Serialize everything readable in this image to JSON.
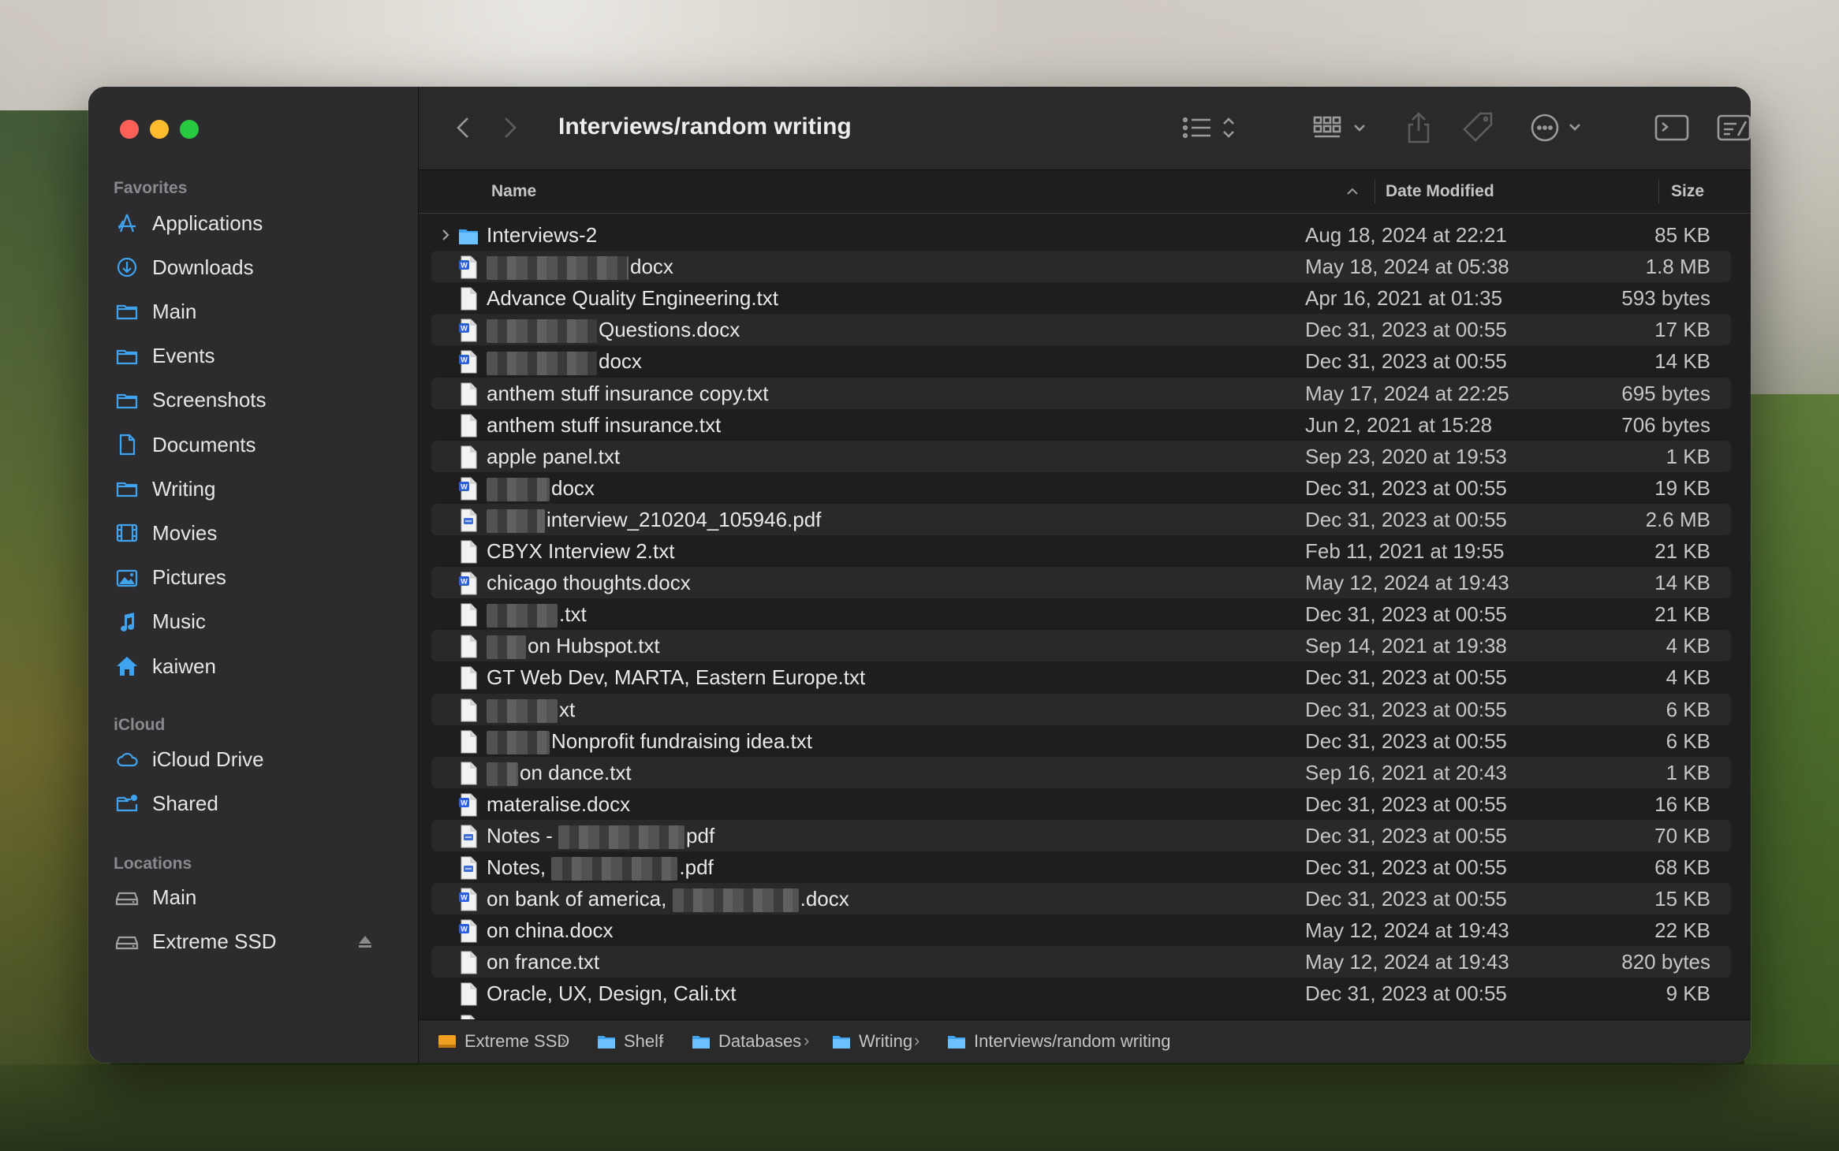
{
  "window": {
    "title": "Interviews/random writing"
  },
  "sidebar": {
    "favorites_label": "Favorites",
    "favorites": [
      {
        "label": "Applications",
        "icon": "applications-icon"
      },
      {
        "label": "Downloads",
        "icon": "downloads-icon"
      },
      {
        "label": "Main",
        "icon": "folder-icon"
      },
      {
        "label": "Events",
        "icon": "folder-icon"
      },
      {
        "label": "Screenshots",
        "icon": "folder-icon"
      },
      {
        "label": "Documents",
        "icon": "document-icon"
      },
      {
        "label": "Writing",
        "icon": "folder-icon"
      },
      {
        "label": "Movies",
        "icon": "film-icon"
      },
      {
        "label": "Pictures",
        "icon": "photo-icon"
      },
      {
        "label": "Music",
        "icon": "music-note-icon"
      },
      {
        "label": "kaiwen",
        "icon": "home-icon"
      }
    ],
    "icloud_label": "iCloud",
    "icloud": [
      {
        "label": "iCloud Drive",
        "icon": "cloud-icon"
      },
      {
        "label": "Shared",
        "icon": "shared-folder-icon"
      }
    ],
    "locations_label": "Locations",
    "locations": [
      {
        "label": "Main",
        "icon": "drive-icon"
      },
      {
        "label": "Extreme SSD",
        "icon": "drive-icon"
      }
    ]
  },
  "columns": {
    "name": "Name",
    "date": "Date Modified",
    "size": "Size"
  },
  "files": [
    {
      "name": "Interviews-2",
      "date": "Aug 18, 2024 at 22:21",
      "size": "85 KB",
      "type": "folder"
    },
    {
      "name": "docx",
      "date": "May 18, 2024 at 05:38",
      "size": "1.8 MB",
      "type": "docx",
      "blur": true
    },
    {
      "name": "Advance Quality Engineering.txt",
      "date": "Apr 16, 2021 at 01:35",
      "size": "593 bytes",
      "type": "txt"
    },
    {
      "name": "Questions.docx",
      "date": "Dec 31, 2023 at 00:55",
      "size": "17 KB",
      "type": "docx",
      "blur": true
    },
    {
      "name": "docx",
      "date": "Dec 31, 2023 at 00:55",
      "size": "14 KB",
      "type": "docx",
      "blur": true
    },
    {
      "name": "anthem stuff insurance copy.txt",
      "date": "May 17, 2024 at 22:25",
      "size": "695 bytes",
      "type": "txt"
    },
    {
      "name": "anthem stuff insurance.txt",
      "date": "Jun 2, 2021 at 15:28",
      "size": "706 bytes",
      "type": "txt"
    },
    {
      "name": "apple panel.txt",
      "date": "Sep 23, 2020 at 19:53",
      "size": "1 KB",
      "type": "txt"
    },
    {
      "name": "docx",
      "date": "Dec 31, 2023 at 00:55",
      "size": "19 KB",
      "type": "docx",
      "blur": true
    },
    {
      "name": "interview_210204_105946.pdf",
      "date": "Dec 31, 2023 at 00:55",
      "size": "2.6 MB",
      "type": "pdf",
      "blur": true
    },
    {
      "name": "CBYX Interview 2.txt",
      "date": "Feb 11, 2021 at 19:55",
      "size": "21 KB",
      "type": "txt"
    },
    {
      "name": "chicago thoughts.docx",
      "date": "May 12, 2024 at 19:43",
      "size": "14 KB",
      "type": "docx"
    },
    {
      "name": ".txt",
      "date": "Dec 31, 2023 at 00:55",
      "size": "21 KB",
      "type": "txt",
      "blur": true
    },
    {
      "name": "on Hubspot.txt",
      "date": "Sep 14, 2021 at 19:38",
      "size": "4 KB",
      "type": "txt",
      "blur": true
    },
    {
      "name": "GT Web Dev, MARTA, Eastern Europe.txt",
      "date": "Dec 31, 2023 at 00:55",
      "size": "4 KB",
      "type": "txt"
    },
    {
      "name": "xt",
      "date": "Dec 31, 2023 at 00:55",
      "size": "6 KB",
      "type": "txt",
      "blur": true
    },
    {
      "name": "Nonprofit fundraising idea.txt",
      "date": "Dec 31, 2023 at 00:55",
      "size": "6 KB",
      "type": "txt",
      "blur": true
    },
    {
      "name": "on dance.txt",
      "date": "Sep 16, 2021 at 20:43",
      "size": "1 KB",
      "type": "txt",
      "blur": true
    },
    {
      "name": "materalise.docx",
      "date": "Dec 31, 2023 at 00:55",
      "size": "16 KB",
      "type": "docx"
    },
    {
      "name": "Notes -",
      "name_tail": "pdf",
      "date": "Dec 31, 2023 at 00:55",
      "size": "70 KB",
      "type": "pdf",
      "mid_blur": true
    },
    {
      "name": "Notes,",
      "name_tail": ".pdf",
      "date": "Dec 31, 2023 at 00:55",
      "size": "68 KB",
      "type": "pdf",
      "mid_blur": true
    },
    {
      "name": "on bank of america,",
      "name_tail": ".docx",
      "date": "Dec 31, 2023 at 00:55",
      "size": "15 KB",
      "type": "docx",
      "mid_blur": true
    },
    {
      "name": "on china.docx",
      "date": "May 12, 2024 at 19:43",
      "size": "22 KB",
      "type": "docx"
    },
    {
      "name": "on france.txt",
      "date": "May 12, 2024 at 19:43",
      "size": "820 bytes",
      "type": "txt"
    },
    {
      "name": "Oracle, UX, Design, Cali.txt",
      "date": "Dec 31, 2023 at 00:55",
      "size": "9 KB",
      "type": "txt"
    }
  ],
  "pathbar": [
    {
      "label": "Extreme SSD",
      "icon": "drive-icon"
    },
    {
      "label": "Shelf",
      "icon": "folder-icon"
    },
    {
      "label": "Databases",
      "icon": "folder-icon"
    },
    {
      "label": "Writing",
      "icon": "folder-icon"
    },
    {
      "label": "Interviews/random writing",
      "icon": "folder-icon"
    }
  ],
  "colors": {
    "accent": "#3b82f6",
    "folder": "#3fa3f0",
    "word": "#2b5fd9"
  }
}
